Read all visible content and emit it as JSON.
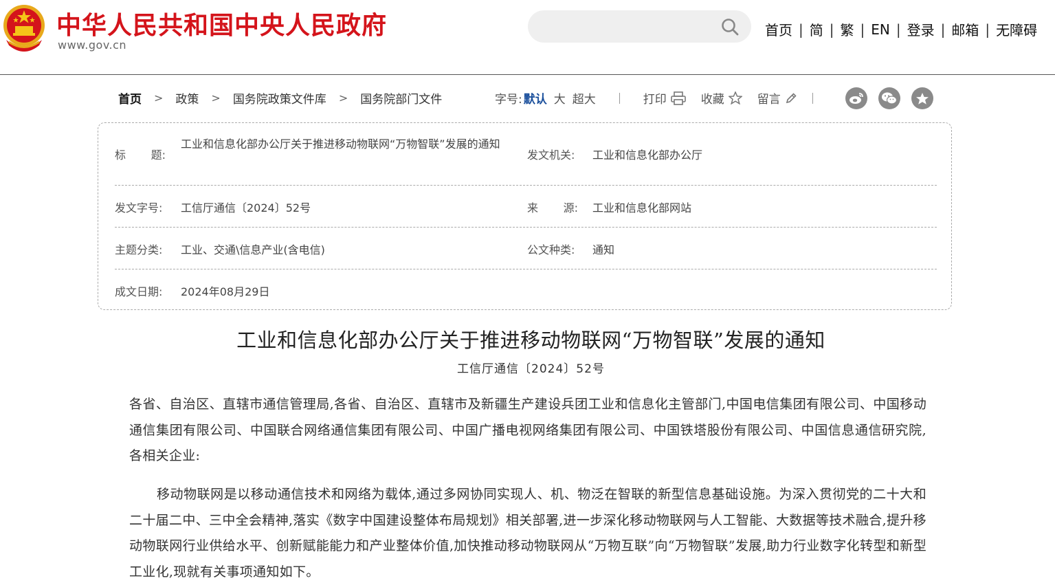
{
  "header": {
    "site_title": "中华人民共和国中央人民政府",
    "site_url": "www.gov.cn",
    "search_placeholder": "",
    "nav": [
      "首页",
      "简",
      "繁",
      "EN",
      "登录",
      "邮箱",
      "无障碍"
    ]
  },
  "breadcrumb": [
    "首页",
    "政策",
    "国务院政策文件库",
    "国务院部门文件"
  ],
  "toolbar": {
    "font_label": "字号:",
    "font_default": "默认",
    "font_large": "大",
    "font_xlarge": "超大",
    "print": "打印",
    "favorite": "收藏",
    "comment": "留言"
  },
  "share_icons": [
    "weibo-icon",
    "wechat-icon",
    "star-circle-icon"
  ],
  "info_table": {
    "title_label_a": "标",
    "title_label_b": "题:",
    "title_value": "工业和信息化部办公厅关于推进移动物联网“万物智联”发展的通知",
    "issuer_label": "发文机关:",
    "issuer_value": "工业和信息化部办公厅",
    "docno_label": "发文字号:",
    "docno_value": "工信厅通信〔2024〕52号",
    "source_label_a": "来",
    "source_label_b": "源:",
    "source_value": "工业和信息化部网站",
    "category_label": "主题分类:",
    "category_value": "工业、交通\\信息产业(含电信)",
    "doctype_label": "公文种类:",
    "doctype_value": "通知",
    "date_label": "成文日期:",
    "date_value": "2024年08月29日"
  },
  "article": {
    "title": "工业和信息化部办公厅关于推进移动物联网“万物智联”发展的通知",
    "doc_number": "工信厅通信〔2024〕52号",
    "paragraphs": [
      "各省、自治区、直辖市通信管理局,各省、自治区、直辖市及新疆生产建设兵团工业和信息化主管部门,中国电信集团有限公司、中国移动通信集团有限公司、中国联合网络通信集团有限公司、中国广播电视网络集团有限公司、中国铁塔股份有限公司、中国信息通信研究院,各相关企业:",
      "移动物联网是以移动通信技术和网络为载体,通过多网协同实现人、机、物泛在智联的新型信息基础设施。为深入贯彻党的二十大和二十届二中、三中全会精神,落实《数字中国建设整体布局规划》相关部署,进一步深化移动物联网与人工智能、大数据等技术融合,提升移动物联网行业供给水平、创新赋能能力和产业整体价值,加快推动移动物联网从“万物互联”向“万物智联”发展,助力行业数字化转型和新型工业化,现就有关事项通知如下。"
    ]
  },
  "colors": {
    "brand_red": "#d4141b",
    "link_blue": "#1a4f9c",
    "icon_gray": "#8a8a8a"
  }
}
